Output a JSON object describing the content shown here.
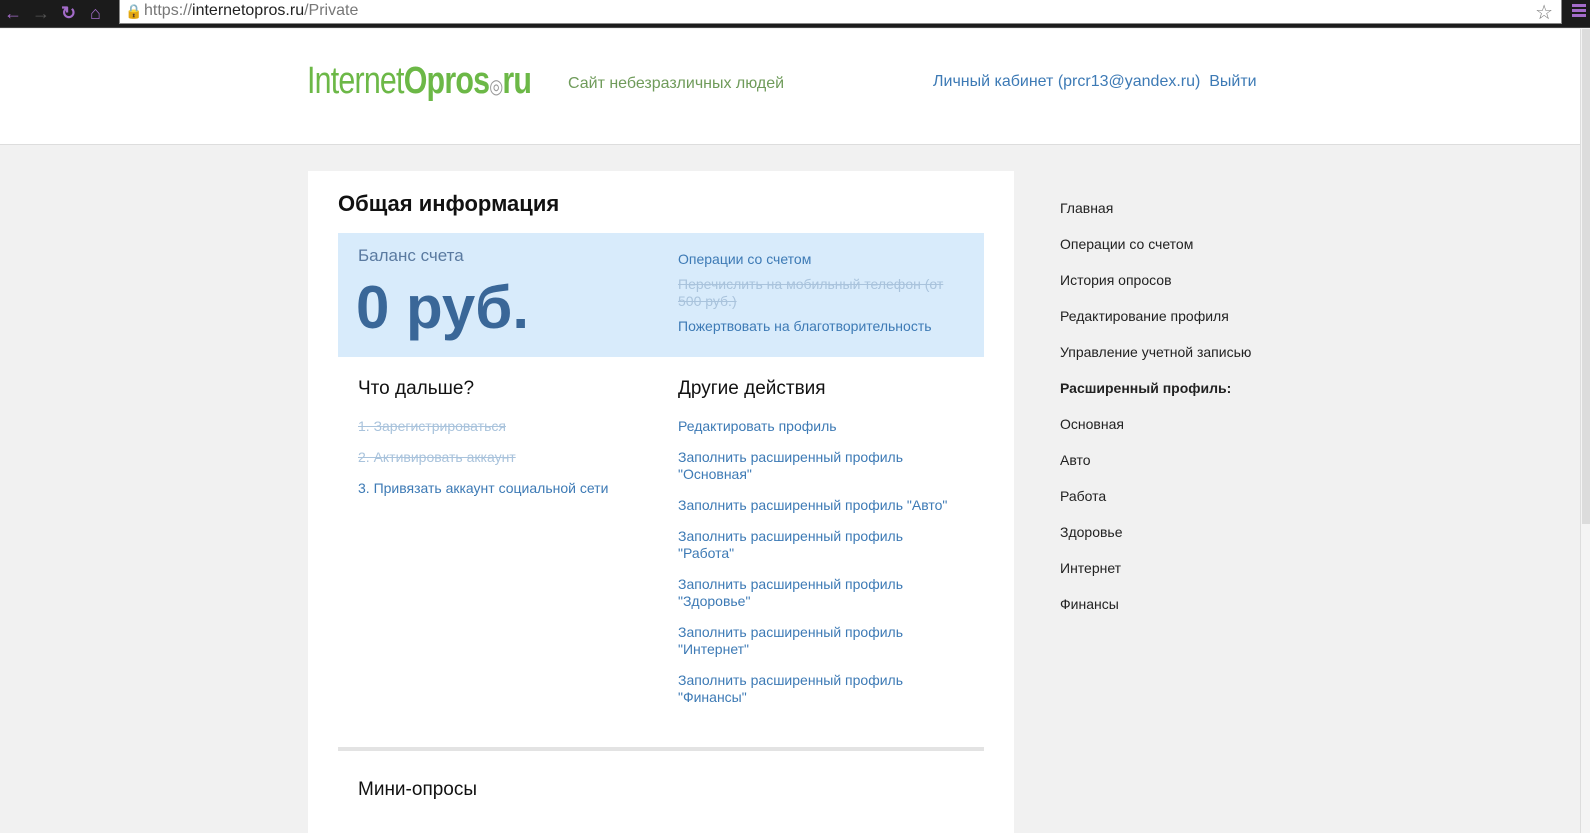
{
  "browser": {
    "url_prefix": "https://",
    "url_host": "internetopros.ru",
    "url_path": "/Private",
    "back": "←",
    "forward": "→",
    "reload": "↻",
    "home": "⌂",
    "star": "☆"
  },
  "header": {
    "logo_a": "Internet",
    "logo_b": "Opros",
    "logo_dot": "◎",
    "logo_c": "ru",
    "tagline": "Сайт небезразличных людей",
    "account": "Личный кабинет (prcr13@yandex.ru)",
    "logout": "Выйти"
  },
  "main": {
    "title": "Общая информация",
    "balance": {
      "label": "Баланс счета",
      "amount": "0 руб.",
      "ops": "Операции со счетом",
      "mobile": "Перечислить на мобильный телефон (от 500 руб.)",
      "donate": "Пожертвовать на благотворительность"
    },
    "next": {
      "title": "Что дальше?",
      "steps": [
        "1. Зарегистрироваться",
        "2. Активировать аккаунт",
        "3. Привязать аккаунт социальной сети"
      ]
    },
    "other": {
      "title": "Другие действия",
      "links": [
        "Редактировать профиль",
        "Заполнить расширенный профиль \"Основная\"",
        "Заполнить расширенный профиль \"Авто\"",
        "Заполнить расширенный профиль \"Работа\"",
        "Заполнить расширенный профиль \"Здоровье\"",
        "Заполнить расширенный профиль \"Интернет\"",
        "Заполнить расширенный профиль \"Финансы\""
      ]
    },
    "mini_title": "Мини-опросы"
  },
  "sidebar": [
    "Главная",
    "Операции со счетом",
    "История опросов",
    "Редактирование профиля",
    "Управление учетной записью",
    "Расширенный профиль:",
    "Основная",
    "Авто",
    "Работа",
    "Здоровье",
    "Интернет",
    "Финансы"
  ]
}
